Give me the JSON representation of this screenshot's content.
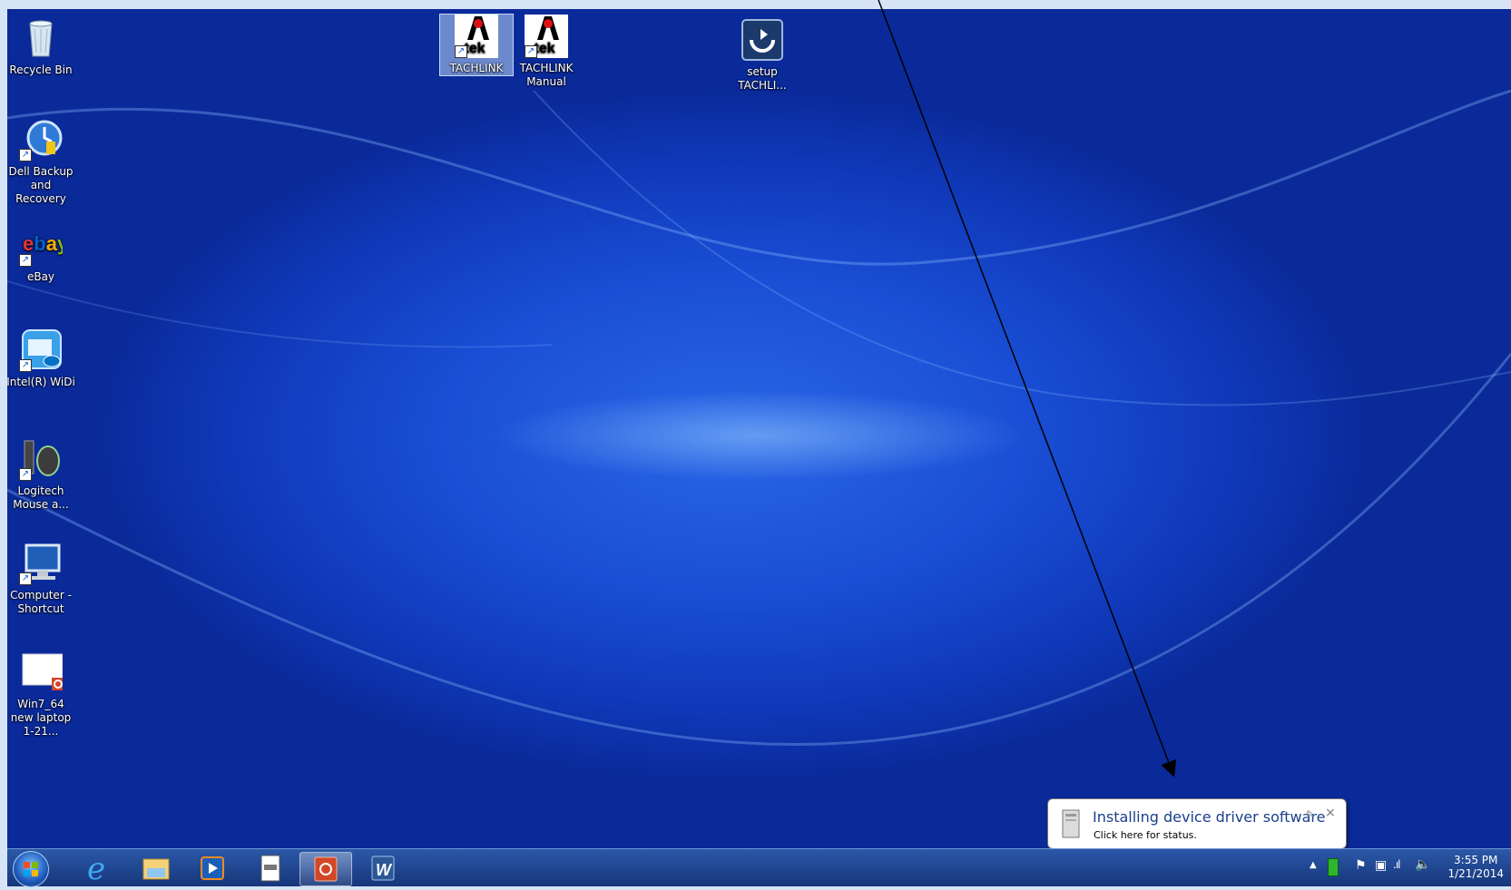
{
  "desktop": {
    "icons": [
      {
        "label": "Recycle Bin"
      },
      {
        "label": "Dell Backup and Recovery"
      },
      {
        "label": "eBay"
      },
      {
        "label": "Intel(R) WiDi"
      },
      {
        "label": "Logitech Mouse a..."
      },
      {
        "label": "Computer - Shortcut"
      },
      {
        "label": "Win7_64 new laptop 1-21..."
      },
      {
        "label": "TACHLINK"
      },
      {
        "label": "TACHLINK Manual"
      },
      {
        "label": "setup TACHLI..."
      }
    ]
  },
  "notification": {
    "title": "Installing device driver software",
    "subtitle": "Click here for status."
  },
  "taskbar": {
    "apps": [
      "internet-explorer-icon",
      "windows-explorer-icon",
      "media-player-icon",
      "notepad-icon",
      "powerpoint-icon",
      "word-icon"
    ],
    "clock_time": "3:55 PM",
    "clock_date": "1/21/2014"
  },
  "colors": {
    "desktop_blue": "#1a4fd6",
    "taskbar": "#1e4690",
    "balloon_title": "#1a3f8c"
  }
}
